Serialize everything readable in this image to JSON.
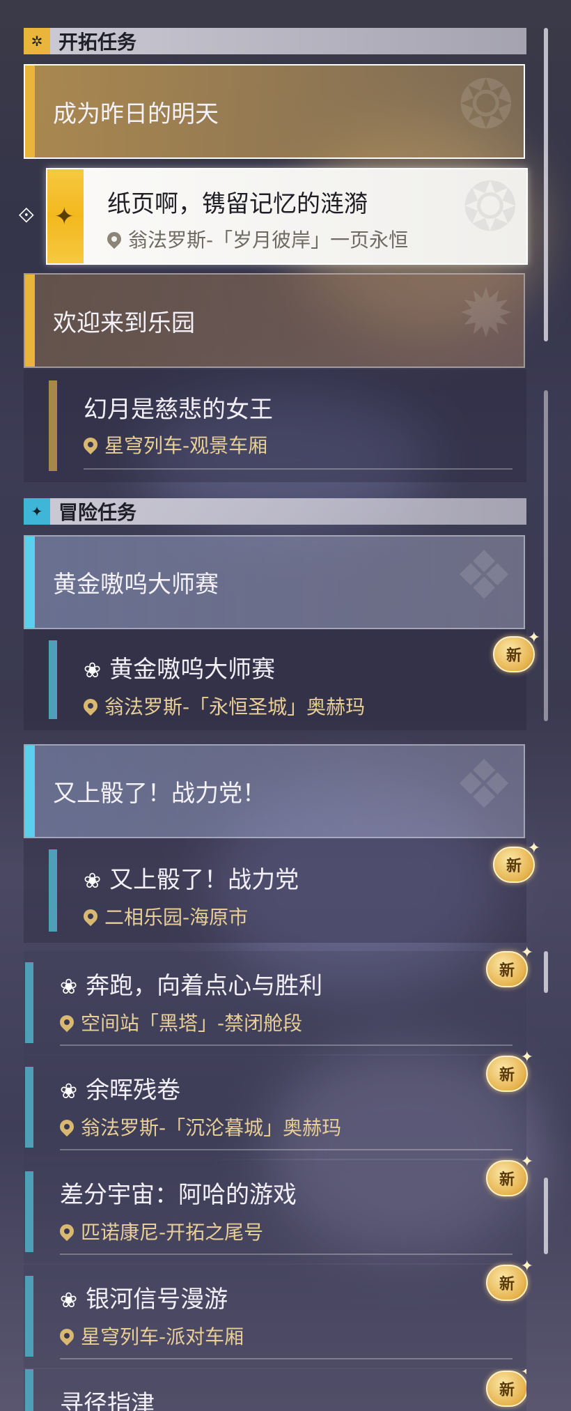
{
  "sections": {
    "trailblaze": {
      "title": "开拓任务",
      "icon": "trailblaze-icon"
    },
    "adventure": {
      "title": "冒险任务",
      "icon": "adventure-icon"
    }
  },
  "trailblaze_groups": [
    {
      "label": "成为昨日的明天"
    },
    {
      "label": "欢迎来到乐园"
    }
  ],
  "selected_quest": {
    "name": "纸页啊，镌留记忆的涟漪",
    "location": "翁法罗斯-「岁月彼岸」一页永恒"
  },
  "trailblaze_quests": [
    {
      "name": "幻月是慈悲的女王",
      "location": "星穹列车-观景车厢"
    }
  ],
  "adventure_groups": [
    {
      "label": "黄金嗷呜大师赛"
    },
    {
      "label": "又上骰了！战力党！"
    }
  ],
  "adventure_quests": [
    {
      "name": "黄金嗷呜大师赛",
      "location": "翁法罗斯-「永恒圣城」奥赫玛",
      "new": "新"
    },
    {
      "name": "又上骰了！战力党",
      "location": "二相乐园-海原市",
      "new": "新"
    },
    {
      "name": "奔跑，向着点心与胜利",
      "location": "空间站「黑塔」-禁闭舱段",
      "new": "新"
    },
    {
      "name": "余晖残卷",
      "location": "翁法罗斯-「沉沦暮城」奥赫玛",
      "new": "新"
    },
    {
      "name": "差分宇宙：阿哈的游戏",
      "location": "匹诺康尼-开拓之尾号",
      "new": "新"
    },
    {
      "name": "银河信号漫游",
      "location": "星穹列车-派对车厢",
      "new": "新"
    },
    {
      "name": "寻径指津",
      "new": "新"
    }
  ],
  "colors": {
    "trailblaze_accent": "#e9b53a",
    "adventure_accent": "#5ad0ee",
    "location_text": "#e8cf97"
  }
}
